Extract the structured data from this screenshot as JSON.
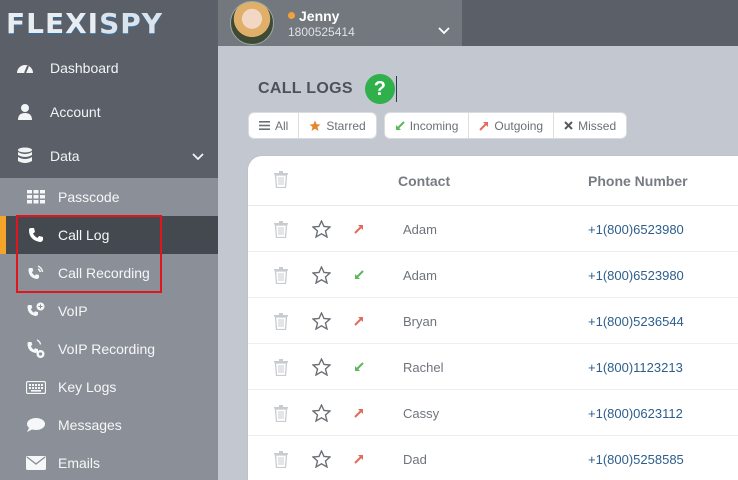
{
  "logo": {
    "part1": "FLEXI",
    "part2": "SPY"
  },
  "user": {
    "name": "Jenny",
    "number": "1800525414"
  },
  "nav": [
    {
      "label": "Dashboard",
      "icon": "dashboard-icon"
    },
    {
      "label": "Account",
      "icon": "user-icon"
    },
    {
      "label": "Data",
      "icon": "database-icon"
    }
  ],
  "subnav": [
    {
      "label": "Passcode",
      "icon": "keypad-icon"
    },
    {
      "label": "Call Log",
      "icon": "phone-icon"
    },
    {
      "label": "Call Recording",
      "icon": "call-recording-icon"
    },
    {
      "label": "VoIP",
      "icon": "voip-icon"
    },
    {
      "label": "VoIP Recording",
      "icon": "voip-recording-icon"
    },
    {
      "label": "Key Logs",
      "icon": "keyboard-icon"
    },
    {
      "label": "Messages",
      "icon": "chat-bubble-icon"
    },
    {
      "label": "Emails",
      "icon": "envelope-icon"
    }
  ],
  "page": {
    "title": "CALL LOGS",
    "help": "?"
  },
  "filters": {
    "all": "All",
    "starred": "Starred",
    "incoming": "Incoming",
    "outgoing": "Outgoing",
    "missed": "Missed"
  },
  "table": {
    "headers": {
      "contact": "Contact",
      "phone": "Phone Number"
    },
    "rows": [
      {
        "contact": "Adam",
        "phone": "+1(800)6523980",
        "direction": "outgoing"
      },
      {
        "contact": "Adam",
        "phone": "+1(800)6523980",
        "direction": "incoming"
      },
      {
        "contact": "Bryan",
        "phone": "+1(800)5236544",
        "direction": "outgoing"
      },
      {
        "contact": "Rachel",
        "phone": "+1(800)1123213",
        "direction": "incoming"
      },
      {
        "contact": "Cassy",
        "phone": "+1(800)0623112",
        "direction": "outgoing"
      },
      {
        "contact": "Dad",
        "phone": "+1(800)5258585",
        "direction": "outgoing"
      }
    ]
  },
  "colors": {
    "accent": "#f4a428",
    "highlight": "#e0161c",
    "incoming": "#5cb85c",
    "outgoing": "#e36b5a",
    "help": "#2fb04a"
  }
}
